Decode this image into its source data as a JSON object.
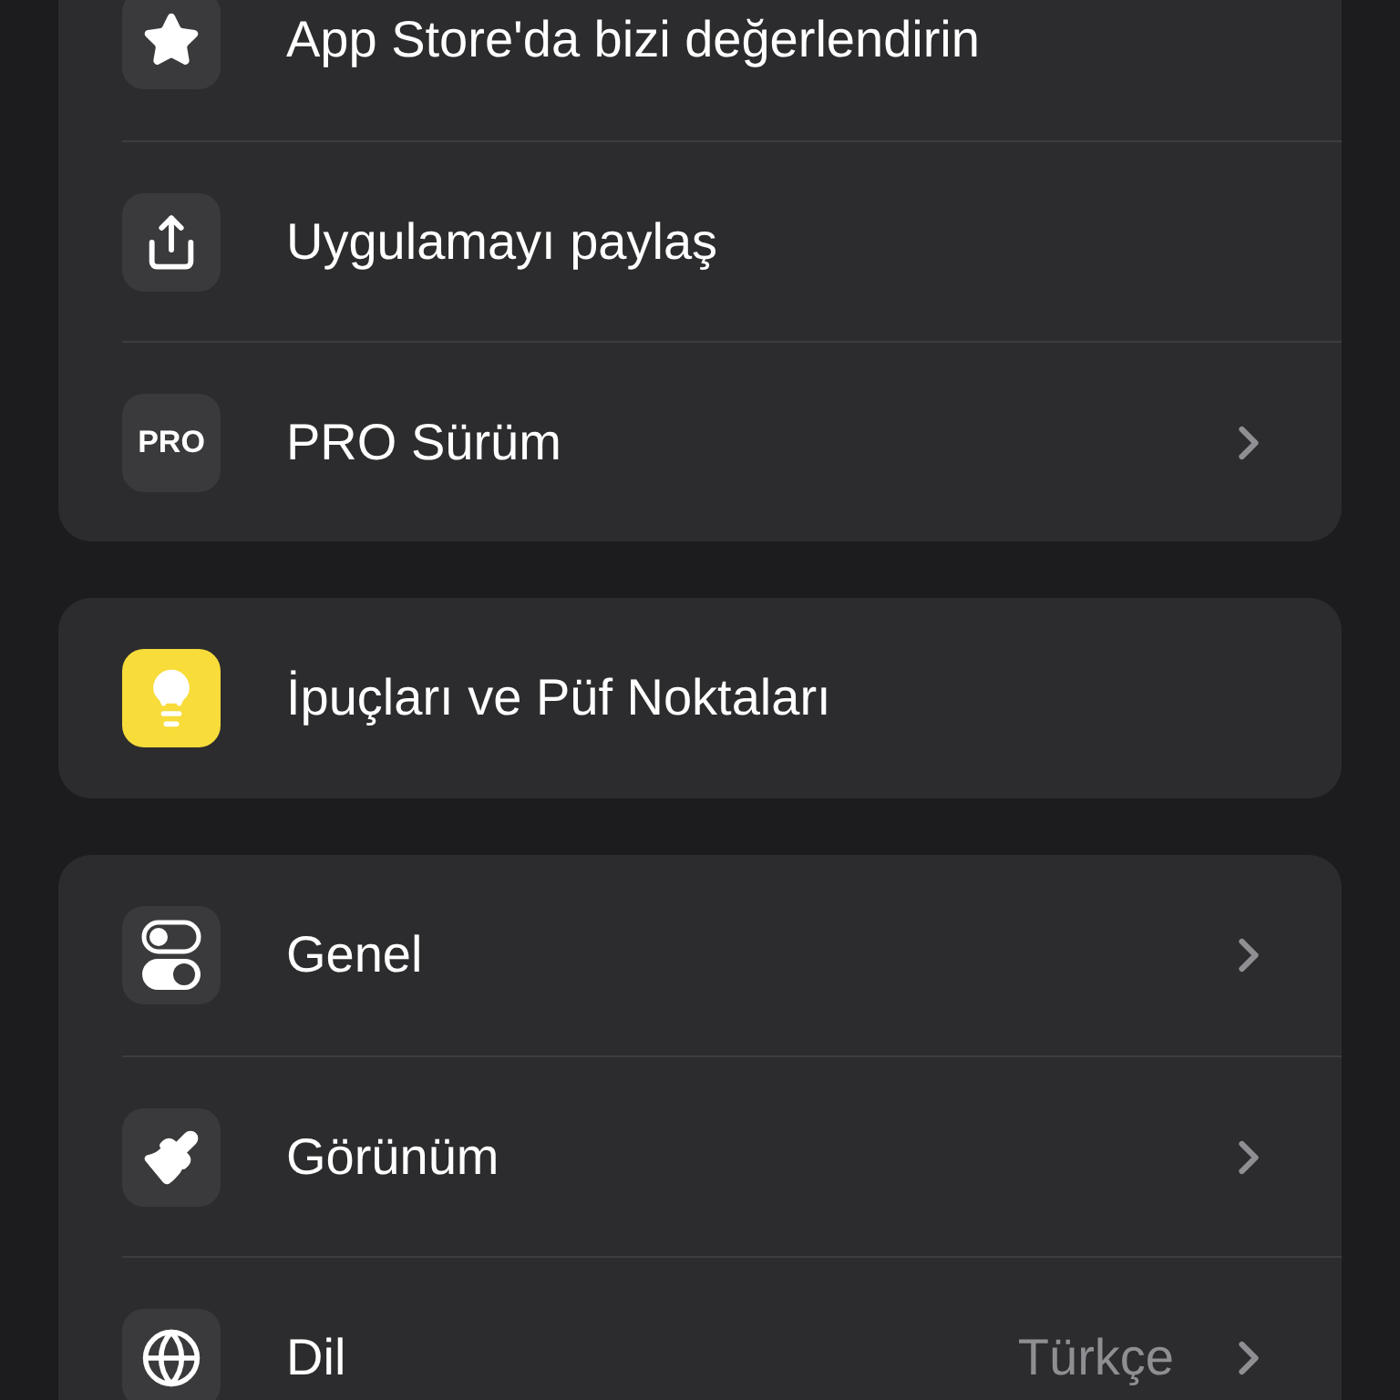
{
  "sections": [
    {
      "items": [
        {
          "kind": "star",
          "label": "App Store'da bizi değerlendirin",
          "chevron": false
        },
        {
          "kind": "share",
          "label": "Uygulamayı paylaş",
          "chevron": false
        },
        {
          "kind": "pro",
          "icon_text": "PRO",
          "label": "PRO Sürüm",
          "chevron": true
        }
      ]
    },
    {
      "items": [
        {
          "kind": "bulb",
          "label": "İpuçları ve Püf Noktaları",
          "chevron": false
        }
      ]
    },
    {
      "items": [
        {
          "kind": "toggles",
          "label": "Genel",
          "chevron": true
        },
        {
          "kind": "brush",
          "label": "Görünüm",
          "chevron": true
        },
        {
          "kind": "globe",
          "label": "Dil",
          "value": "Türkçe",
          "chevron": true
        }
      ]
    }
  ]
}
